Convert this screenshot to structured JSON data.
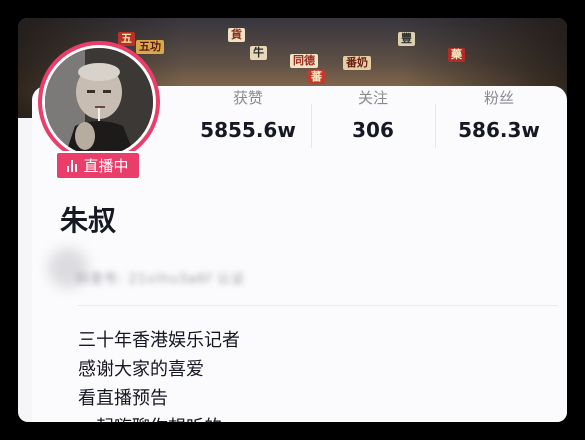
{
  "header": {
    "banner_signs": [
      "五功",
      "同德",
      "番奶",
      "五",
      "貨",
      "牛",
      "蕃",
      "豐",
      "藥"
    ]
  },
  "profile": {
    "live_badge": "直播中",
    "name": "朱叔",
    "account_id_blurred": "抖音号: 21vlhu3a6f 认证",
    "stats": [
      {
        "label": "获赞",
        "value": "5855.6w"
      },
      {
        "label": "关注",
        "value": "306"
      },
      {
        "label": "粉丝",
        "value": "586.3w"
      }
    ],
    "bio_lines": [
      "三十年香港娱乐记者",
      "感谢大家的喜爱",
      "看直播预告",
      "一起嗨聊你想听的……"
    ]
  },
  "colors": {
    "live_accent": "#ea3d6a",
    "text_primary": "#161823",
    "text_secondary": "#8a8a90",
    "card_bg": "#fbfafc"
  },
  "icons": {
    "live": "live-bars-icon"
  }
}
